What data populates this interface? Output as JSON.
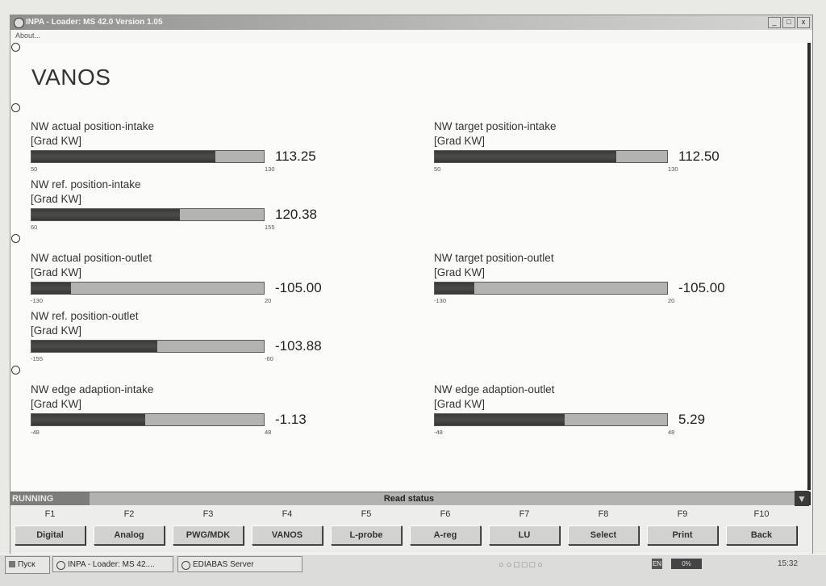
{
  "window": {
    "title": "INPA - Loader: MS 42.0 Version 1.05",
    "menu_about": "About...",
    "btn_minimize": "_",
    "btn_restore": "□",
    "btn_close": "x"
  },
  "page_title": "VANOS",
  "gauges": [
    {
      "label": "NW actual position-intake",
      "unit": "[Grad KW]",
      "value_text": "113.25",
      "min": "50",
      "max": "130",
      "level": 0.79
    },
    {
      "label": "NW target position-intake",
      "unit": "[Grad KW]",
      "value_text": "112.50",
      "min": "50",
      "max": "130",
      "level": 0.78
    },
    {
      "label": "NW ref. position-intake",
      "unit": "[Grad KW]",
      "value_text": "120.38",
      "min": "60",
      "max": "155",
      "level": 0.64
    },
    {
      "label": "NW actual position-outlet",
      "unit": "[Grad KW]",
      "value_text": "-105.00",
      "min": "-130",
      "max": "20",
      "level": 0.17
    },
    {
      "label": "NW target position-outlet",
      "unit": "[Grad KW]",
      "value_text": "-105.00",
      "min": "-130",
      "max": "20",
      "level": 0.17
    },
    {
      "label": "NW ref. position-outlet",
      "unit": "[Grad KW]",
      "value_text": "-103.88",
      "min": "-155",
      "max": "-60",
      "level": 0.54
    },
    {
      "label": "NW edge adaption-intake",
      "unit": "[Grad KW]",
      "value_text": "-1.13",
      "min": "-48",
      "max": "48",
      "level": 0.49
    },
    {
      "label": "NW edge adaption-outlet",
      "unit": "[Grad KW]",
      "value_text": "5.29",
      "min": "-48",
      "max": "48",
      "level": 0.56
    }
  ],
  "status": {
    "state": "RUNNING",
    "message": "Read status"
  },
  "fkeys": [
    {
      "key": "F1",
      "label": "Digital"
    },
    {
      "key": "F2",
      "label": "Analog"
    },
    {
      "key": "F3",
      "label": "PWG/MDK"
    },
    {
      "key": "F4",
      "label": "VANOS"
    },
    {
      "key": "F5",
      "label": "L-probe"
    },
    {
      "key": "F6",
      "label": "A-reg"
    },
    {
      "key": "F7",
      "label": "LU"
    },
    {
      "key": "F8",
      "label": "Select"
    },
    {
      "key": "F9",
      "label": "Print"
    },
    {
      "key": "F10",
      "label": "Back"
    }
  ],
  "taskbar": {
    "start_label": "Пуск",
    "tasks": [
      "INPA - Loader: MS 42....",
      "EDIABAS Server"
    ],
    "lang": "EN",
    "battery": "0%",
    "clock": "15:32"
  },
  "colors": {
    "bar_fill": "#3f3f3d",
    "bar_track": "#b3b3b1",
    "status_running": "#7d7d7b"
  },
  "icons": [
    "app-icon",
    "scroll-down-icon",
    "start-icon",
    "inpa-task-icon",
    "ediabas-task-icon"
  ]
}
